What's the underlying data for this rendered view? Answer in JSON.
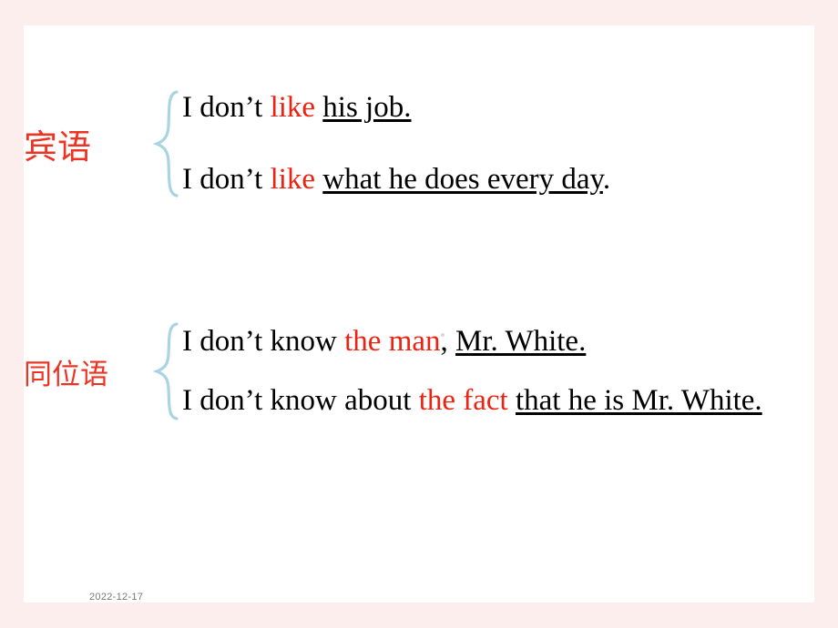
{
  "slide": {
    "date": "2022-12-17",
    "groups": [
      {
        "label": "宾语",
        "brace": "brace-icon",
        "lines": [
          {
            "pre": "I don’t ",
            "highlight": "like",
            "post": " ",
            "underlined": "his job.",
            "tail": ""
          },
          {
            "pre": "I don’t ",
            "highlight": "like",
            "post": " ",
            "underlined": "what he does every day",
            "tail": "."
          }
        ]
      },
      {
        "label": "同位语",
        "brace": "brace-icon",
        "lines": [
          {
            "pre": "I don’t know  ",
            "highlight": "the man",
            "post": ", ",
            "underlined": "Mr. White.",
            "tail": ""
          },
          {
            "pre": "I don’t know about ",
            "highlight": "the fact",
            "post": " ",
            "underlined": "that he is Mr. White.",
            "tail": ""
          }
        ]
      }
    ],
    "colors": {
      "background": "#fdeeee",
      "canvas": "#ffffff",
      "accent_red": "#ee2211",
      "brace": "#a9d4e2",
      "date_text": "#777777"
    }
  }
}
